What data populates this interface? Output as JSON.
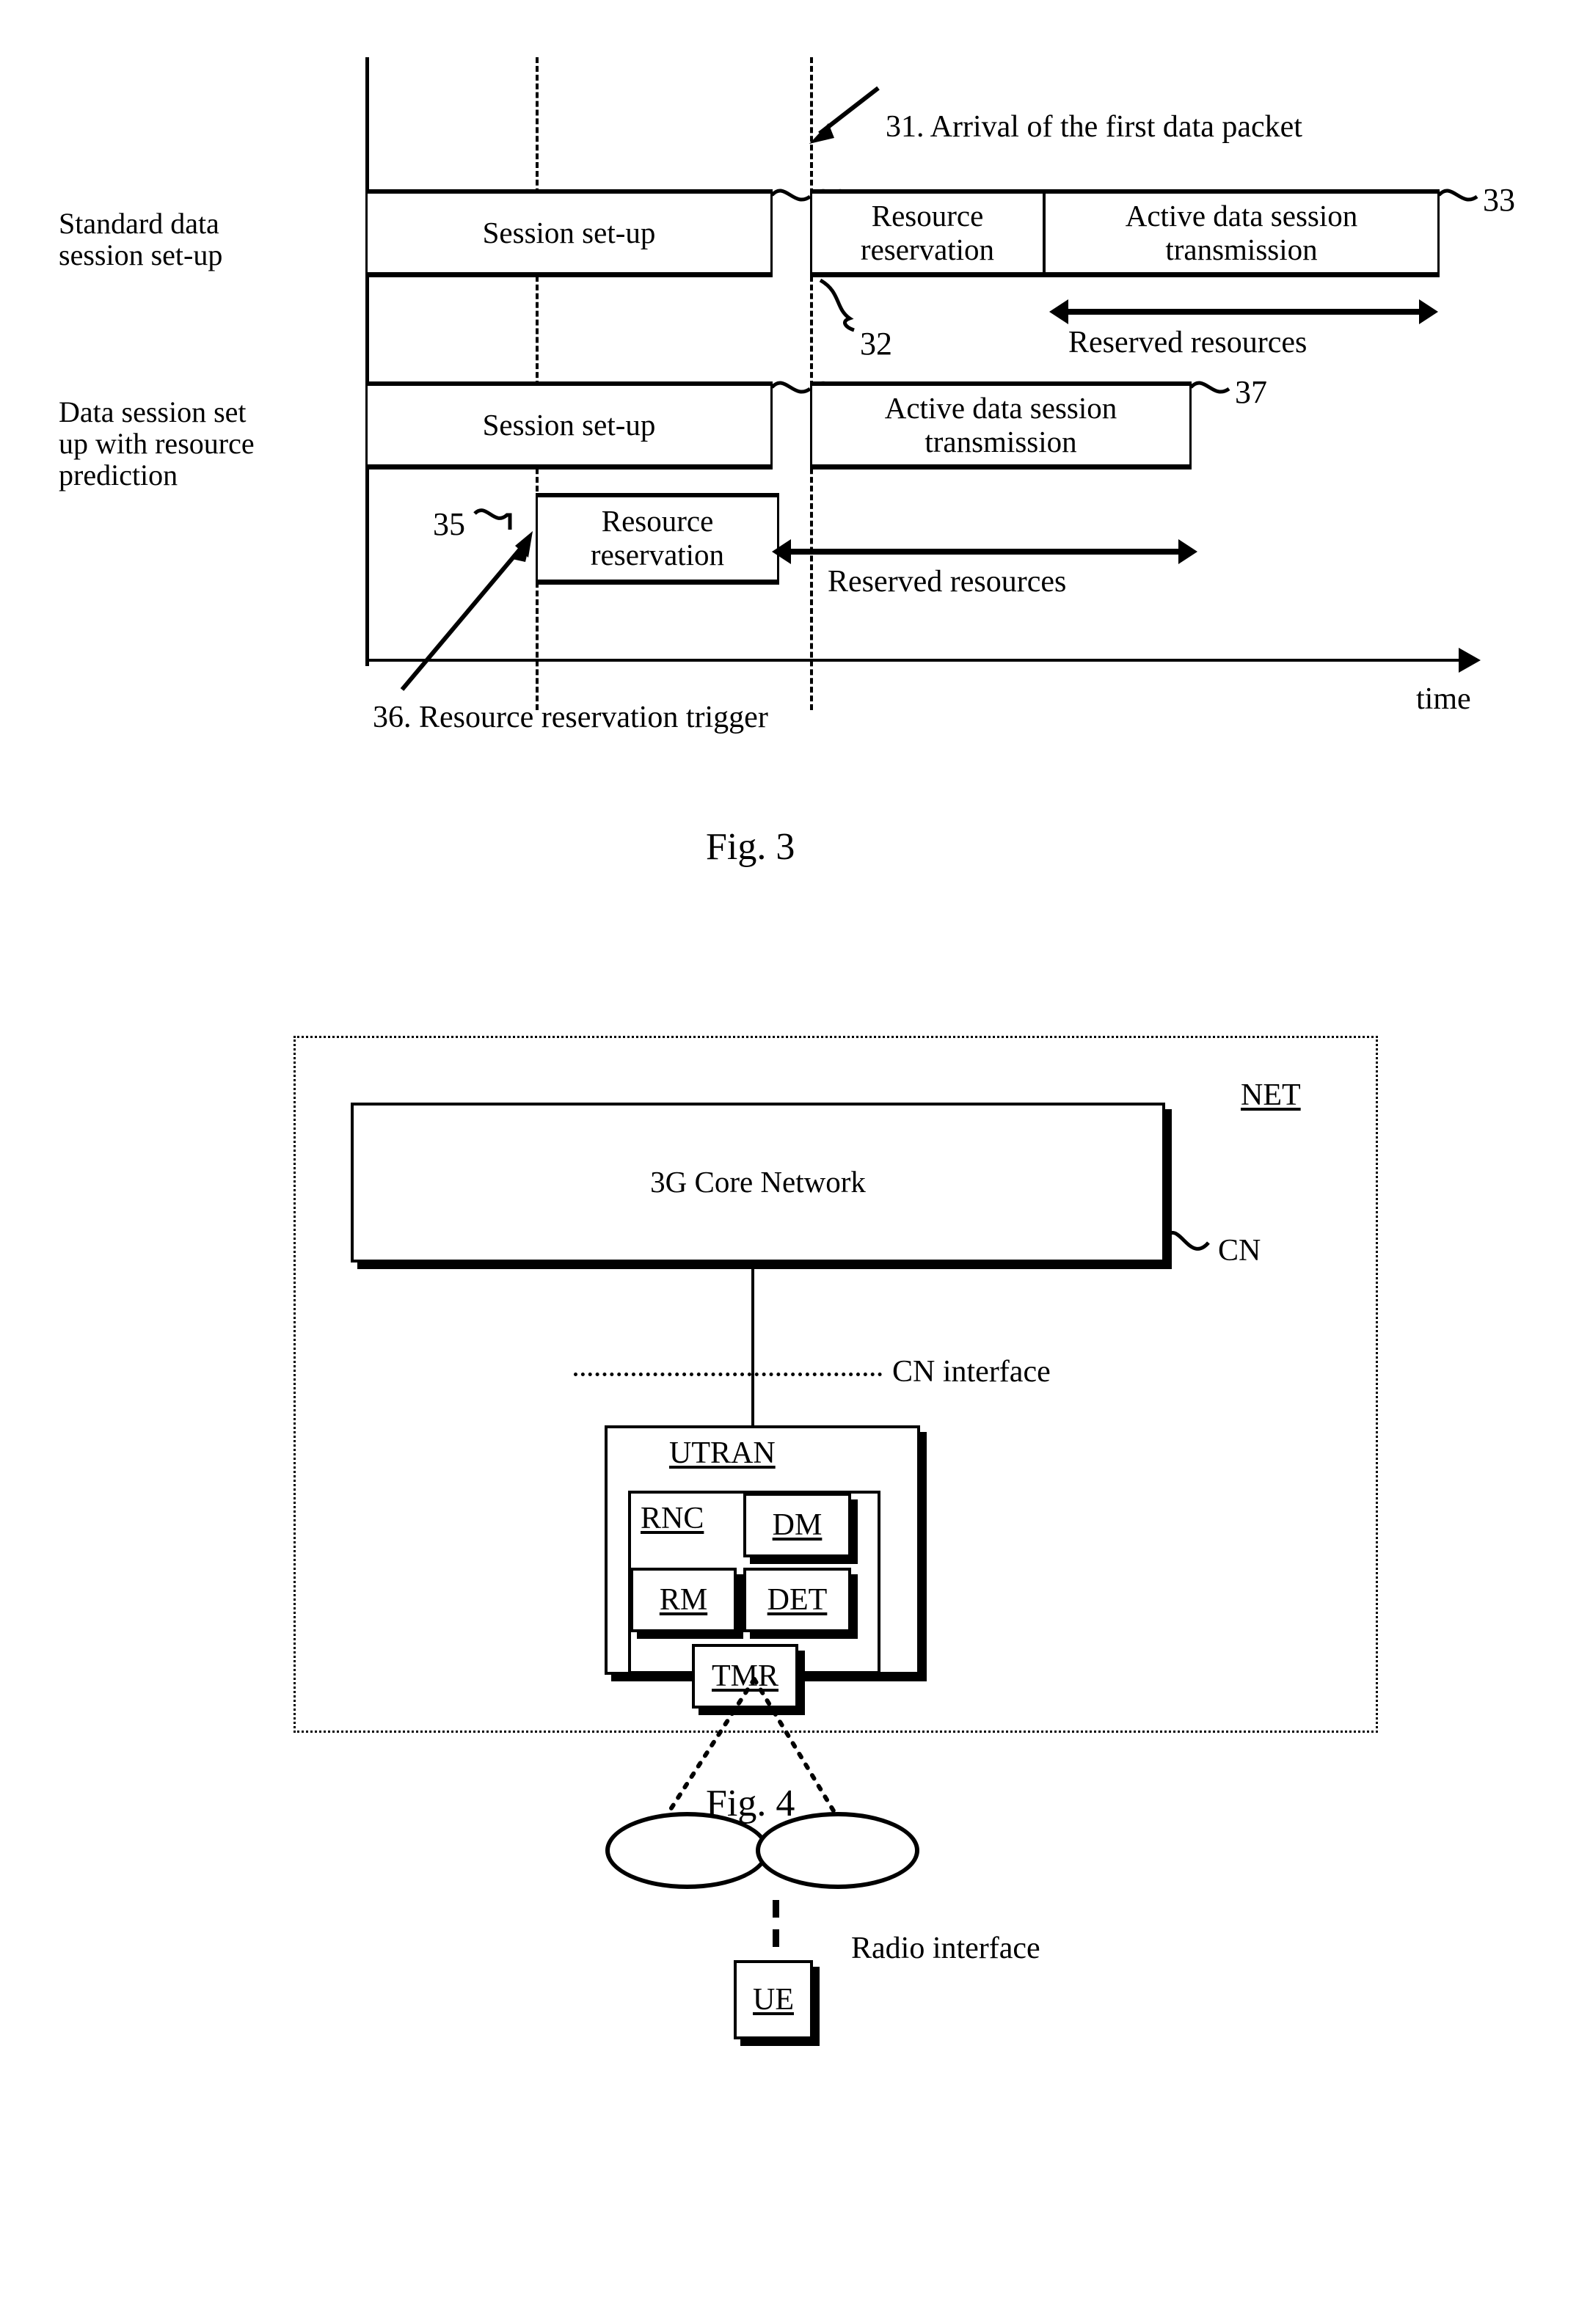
{
  "figure3": {
    "caption": "Fig. 3",
    "row_labels": [
      "Standard data\nsession set-up",
      "Data session set\nup with resource\nprediction"
    ],
    "axis_label": "time",
    "boxes": [
      {
        "id": "30",
        "label": "Session set-up",
        "ref": "30"
      },
      {
        "id": "32",
        "label": "Resource\nreservation",
        "ref": "32"
      },
      {
        "id": "33",
        "label": "Active data session\ntransmission",
        "ref": "33"
      },
      {
        "id": "34",
        "label": "Session set-up",
        "ref": "34"
      },
      {
        "id": "37",
        "label": "Active data session\ntransmission",
        "ref": "37"
      },
      {
        "id": "35",
        "label": "Resource\nreservation",
        "ref": "35"
      }
    ],
    "annotations": {
      "arrival": "31. Arrival of the first data packet",
      "trigger": "36. Resource reservation trigger",
      "reserved_resources_top": "Reserved resources",
      "reserved_resources_bottom": "Reserved resources"
    }
  },
  "figure4": {
    "caption": "Fig. 4",
    "net_label": "NET",
    "core_network": "3G Core Network",
    "cn_ref": "CN",
    "cn_interface": "CN interface",
    "utran_label": "UTRAN",
    "rnc_label": "RNC",
    "rnc_modules": [
      {
        "label": "DM"
      },
      {
        "label": "RM"
      },
      {
        "label": "DET"
      },
      {
        "label": "TMR"
      }
    ],
    "radio_interface": "Radio interface",
    "ue_label": "UE"
  },
  "colors": {
    "ink": "#000000",
    "paper": "#ffffff"
  }
}
